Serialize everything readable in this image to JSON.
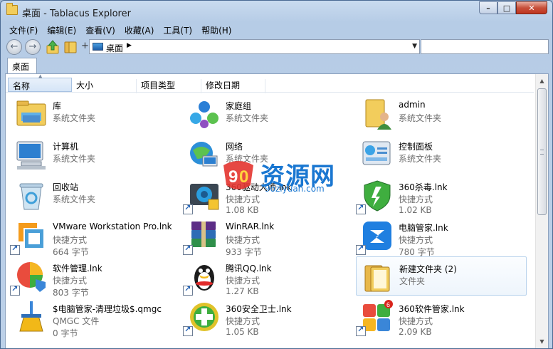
{
  "window": {
    "title": "桌面 - Tablacus Explorer",
    "minimize_glyph": "–",
    "maximize_glyph": "□",
    "close_glyph": "✕"
  },
  "menu": {
    "items": [
      "文件(F)",
      "编辑(E)",
      "查看(V)",
      "收藏(A)",
      "工具(T)",
      "帮助(H)"
    ]
  },
  "nav": {
    "back_glyph": "←",
    "forward_glyph": "→",
    "plus_glyph": "+",
    "address": "桌面",
    "address_caret": "▶",
    "dropdown_glyph": "▼",
    "search_value": ""
  },
  "tabs": [
    {
      "label": "桌面",
      "active": true
    }
  ],
  "columns": [
    "名称",
    "大小",
    "项目类型",
    "修改日期"
  ],
  "sort_glyph": "▲",
  "items": [
    {
      "name": "库",
      "type": "系统文件夹",
      "size": "",
      "icon": "library-icon",
      "shortcut": false,
      "selected": false
    },
    {
      "name": "家庭组",
      "type": "系统文件夹",
      "size": "",
      "icon": "homegroup-icon",
      "shortcut": false,
      "selected": false
    },
    {
      "name": "admin",
      "type": "系统文件夹",
      "size": "",
      "icon": "user-folder-icon",
      "shortcut": false,
      "selected": false
    },
    {
      "name": "计算机",
      "type": "系统文件夹",
      "size": "",
      "icon": "computer-icon",
      "shortcut": false,
      "selected": false
    },
    {
      "name": "网络",
      "type": "系统文件夹",
      "size": "",
      "icon": "network-icon",
      "shortcut": false,
      "selected": false
    },
    {
      "name": "控制面板",
      "type": "系统文件夹",
      "size": "",
      "icon": "control-panel-icon",
      "shortcut": false,
      "selected": false
    },
    {
      "name": "回收站",
      "type": "系统文件夹",
      "size": "",
      "icon": "recycle-bin-icon",
      "shortcut": false,
      "selected": false
    },
    {
      "name": "360驱动大师.lnk",
      "type": "快捷方式",
      "size": "1.08 KB",
      "icon": "driver-master-icon",
      "shortcut": true,
      "selected": false
    },
    {
      "name": "360杀毒.lnk",
      "type": "快捷方式",
      "size": "1.02 KB",
      "icon": "antivirus-shield-icon",
      "shortcut": true,
      "selected": false
    },
    {
      "name": "VMware Workstation Pro.lnk",
      "type": "快捷方式",
      "size": "664 字节",
      "icon": "vmware-icon",
      "shortcut": true,
      "selected": false
    },
    {
      "name": "WinRAR.lnk",
      "type": "快捷方式",
      "size": "933 字节",
      "icon": "winrar-icon",
      "shortcut": true,
      "selected": false
    },
    {
      "name": "电脑管家.lnk",
      "type": "快捷方式",
      "size": "780 字节",
      "icon": "pc-manager-icon",
      "shortcut": true,
      "selected": false
    },
    {
      "name": "软件管理.lnk",
      "type": "快捷方式",
      "size": "803 字节",
      "icon": "software-manager-icon",
      "shortcut": true,
      "selected": false
    },
    {
      "name": "腾讯QQ.lnk",
      "type": "快捷方式",
      "size": "1.27 KB",
      "icon": "qq-penguin-icon",
      "shortcut": true,
      "selected": false
    },
    {
      "name": "新建文件夹 (2)",
      "type": "文件夹",
      "size": "",
      "icon": "folder-icon",
      "shortcut": false,
      "selected": true
    },
    {
      "name": "$电脑管家-清理垃圾$.qmgc",
      "type": "QMGC 文件",
      "size": "0 字节",
      "icon": "broom-icon",
      "shortcut": false,
      "selected": false
    },
    {
      "name": "360安全卫士.lnk",
      "type": "快捷方式",
      "size": "1.05 KB",
      "icon": "safe-guard-icon",
      "shortcut": true,
      "selected": false
    },
    {
      "name": "360软件管家.lnk",
      "type": "快捷方式",
      "size": "2.09 KB",
      "icon": "software-store-icon",
      "shortcut": true,
      "selected": false
    }
  ],
  "watermark": {
    "main": "资源网",
    "sub": "9oziyuan.com"
  },
  "colors": {
    "title_bg": "#c9dbef",
    "selection_border": "#b8d2ec",
    "watermark": "#1a77d1"
  }
}
